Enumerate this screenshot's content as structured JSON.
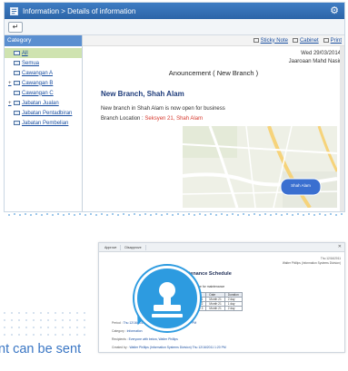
{
  "window1": {
    "breadcrumb": "Information > Details of information",
    "sidebar": {
      "header": "Category",
      "items": [
        {
          "label": "All",
          "selected": true,
          "expander": ""
        },
        {
          "label": "Semua",
          "selected": false,
          "expander": ""
        },
        {
          "label": "Cawangan A",
          "selected": false,
          "expander": ""
        },
        {
          "label": "Cawangan B",
          "selected": false,
          "expander": "+"
        },
        {
          "label": "Cawangan C",
          "selected": false,
          "expander": ""
        },
        {
          "label": "Jabatan Jualan",
          "selected": false,
          "expander": "+"
        },
        {
          "label": "Jabatan Pentadbiran",
          "selected": false,
          "expander": ""
        },
        {
          "label": "Jabatan Pembelian",
          "selected": false,
          "expander": ""
        }
      ]
    },
    "actions": {
      "sticky_note": "Sticky Note",
      "cabinet": "Cabinet",
      "print": "Print"
    },
    "date": "Wed 29/03/2014",
    "author": "Jaaroaan Mahd Nasir",
    "announcement_title": "Anouncement ( New Branch )",
    "branch_title": "New Branch, Shah Alam",
    "description": "New branch in Shah Alam is now open for business",
    "location_label": "Branch Location :",
    "location_value": "Seksyen 21, Shah Alam",
    "map_marker": "Shah Alam"
  },
  "window2": {
    "tabs": [
      "Approve",
      "Disapprove"
    ],
    "date": "Thu 12/16/2011",
    "author": "Walter Phillips (Information Systems Division)",
    "heading": "Facilities Maintenance Schedule",
    "intro": "All listed facilities below will be out of service for maintenance",
    "table": {
      "headers": [
        "Name",
        "Date",
        "Duration"
      ],
      "rows": [
        [
          "Projector 1",
          "Month 21",
          "2 day"
        ],
        [
          "Projector 2",
          "Month 21",
          "1 day"
        ],
        [
          "Projector 3",
          "Month 21",
          "2 day"
        ]
      ]
    },
    "meta": [
      {
        "key": "Period :",
        "value": "Thu 12/16/2011 12:00 AM - Sun 12/18/2011 11:59 PM"
      },
      {
        "key": "Category :",
        "value": "Information"
      },
      {
        "key": "Recipients :",
        "value": "Everyone with below, Walter Phillips"
      },
      {
        "key": "Created by :",
        "value": "Walter Phillips (Information Systems Division) Thu 12/16/2011 1:20 PM"
      }
    ]
  },
  "caption": "nt can be sent",
  "colors": {
    "accent": "#2d9be0",
    "titlebar": "#2d65a8",
    "link": "#1a4fa0",
    "location": "#d63a2f",
    "caption": "#3a76c4"
  },
  "icons": {
    "stamp": "stamp-icon",
    "settings": "gear-icon",
    "back": "back-arrow-icon"
  }
}
